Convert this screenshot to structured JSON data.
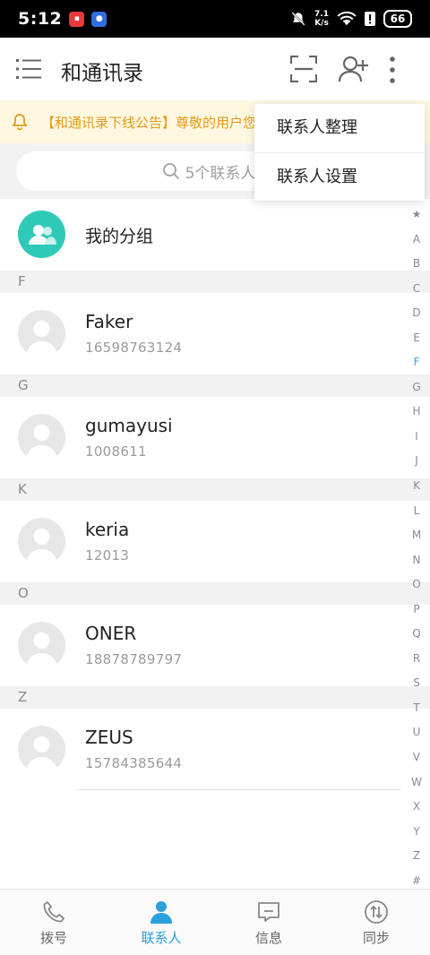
{
  "status_bar": {
    "time": "5:12",
    "net_speed_value": "7.1",
    "net_speed_unit": "K/s",
    "battery": "66"
  },
  "header": {
    "title": "和通讯录"
  },
  "notice": {
    "text": "【和通讯录下线公告】尊敬的用户您"
  },
  "search": {
    "placeholder": "5个联系人"
  },
  "group": {
    "label": "我的分组"
  },
  "menu": {
    "items": [
      "联系人整理",
      "联系人设置"
    ]
  },
  "sections": [
    {
      "letter": "F",
      "contacts": [
        {
          "name": "Faker",
          "phone": "16598763124"
        }
      ]
    },
    {
      "letter": "G",
      "contacts": [
        {
          "name": "gumayusi",
          "phone": "1008611"
        }
      ]
    },
    {
      "letter": "K",
      "contacts": [
        {
          "name": "keria",
          "phone": "12013"
        }
      ]
    },
    {
      "letter": "O",
      "contacts": [
        {
          "name": "ONER",
          "phone": "18878789797"
        }
      ]
    },
    {
      "letter": "Z",
      "contacts": [
        {
          "name": "ZEUS",
          "phone": "15784385644"
        }
      ]
    }
  ],
  "index_bar": {
    "letters": [
      "★",
      "A",
      "B",
      "C",
      "D",
      "E",
      "F",
      "G",
      "H",
      "I",
      "J",
      "K",
      "L",
      "M",
      "N",
      "O",
      "P",
      "Q",
      "R",
      "S",
      "T",
      "U",
      "V",
      "W",
      "X",
      "Y",
      "Z",
      "#"
    ],
    "active": "F"
  },
  "bottom_nav": {
    "items": [
      {
        "label": "拨号",
        "icon": "phone-icon"
      },
      {
        "label": "联系人",
        "icon": "contacts-icon"
      },
      {
        "label": "信息",
        "icon": "message-icon"
      },
      {
        "label": "同步",
        "icon": "sync-icon"
      }
    ],
    "active_index": 1
  },
  "colors": {
    "accent": "#2aa0dd",
    "notice_text": "#e39a17",
    "notice_bg": "#fff8e1",
    "group_avatar": "#2fc9b8"
  }
}
